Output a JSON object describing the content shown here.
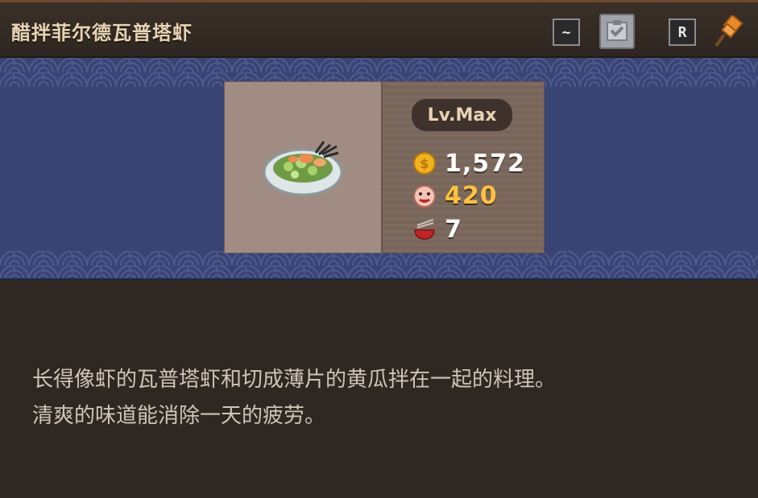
{
  "header": {
    "title": "醋拌菲尔德瓦普塔虾",
    "wave_button_label": "~",
    "r_button_label": "R"
  },
  "icons": {
    "wave": "wave-icon",
    "check": "check-clipboard-icon",
    "pin": "pin-icon",
    "dish": "cucumber-shrimp-salad-icon",
    "coin": "coin-icon",
    "taste": "taste-face-icon",
    "bowl": "bowl-chopsticks-icon"
  },
  "item": {
    "level": "Lv.Max",
    "price": "1,572",
    "taste": "420",
    "count": "7"
  },
  "description": {
    "line1": "长得像虾的瓦普塔虾和切成薄片的黄瓜拌在一起的料理。",
    "line2": "清爽的味道能消除一天的疲劳。"
  },
  "colors": {
    "banner": "#3a4474",
    "title": "#e8d3b2",
    "taste_value": "#ffc23c",
    "pin": "#e88a2a"
  }
}
